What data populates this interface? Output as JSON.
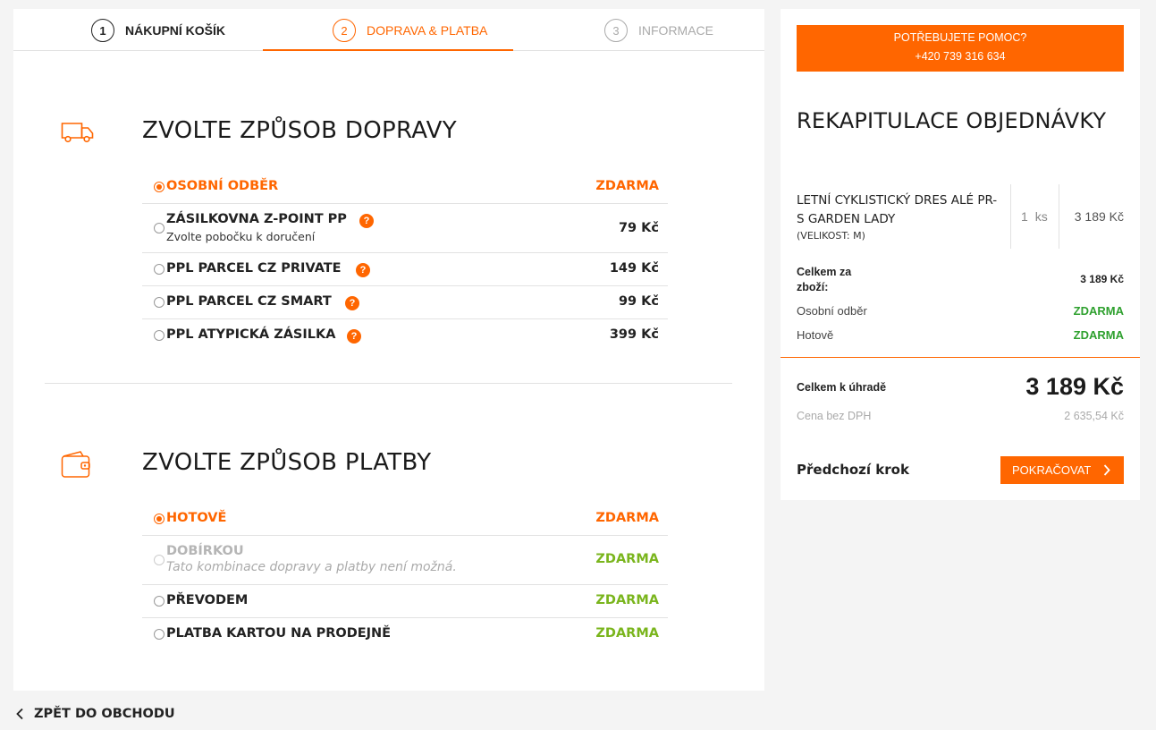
{
  "steps": [
    {
      "num": "1",
      "label": "NÁKUPNÍ KOŠÍK"
    },
    {
      "num": "2",
      "label": "DOPRAVA & PLATBA"
    },
    {
      "num": "3",
      "label": "INFORMACE"
    }
  ],
  "shipping": {
    "title": "ZVOLTE ZPŮSOB DOPRAVY",
    "options": [
      {
        "name": "OSOBNÍ ODBĚR",
        "sub": "",
        "price": "ZDARMA"
      },
      {
        "name": "ZÁSILKOVNA Z-POINT PP",
        "sub": "Zvolte pobočku k doručení",
        "price": "79 Kč",
        "help": "?"
      },
      {
        "name": "PPL PARCEL CZ PRIVATE",
        "sub": "",
        "price": "149 Kč",
        "help": "?"
      },
      {
        "name": "PPL PARCEL CZ SMART",
        "sub": "",
        "price": "99 Kč",
        "help": "?"
      },
      {
        "name": "PPL ATYPICKÁ ZÁSILKA",
        "sub": "",
        "price": "399 Kč",
        "help": "?"
      }
    ]
  },
  "payment": {
    "title": "ZVOLTE ZPŮSOB PLATBY",
    "options": [
      {
        "name": "HOTOVĚ",
        "sub": "",
        "price": "ZDARMA"
      },
      {
        "name": "DOBÍRKOU",
        "sub": "Tato kombinace dopravy a platby není možná.",
        "price": "ZDARMA"
      },
      {
        "name": "PŘEVODEM",
        "sub": "",
        "price": "ZDARMA"
      },
      {
        "name": "PLATBA KARTOU NA PRODEJNĚ",
        "sub": "",
        "price": "ZDARMA"
      }
    ]
  },
  "back_to_shop": "ZPĚT DO OBCHODU",
  "sidebar": {
    "help_line1": "POTŘEBUJETE POMOC?",
    "help_line2": "+420 739 316 634",
    "recap_title": "REKAPITULACE OBJEDNÁVKY",
    "item": {
      "name": "LETNÍ CYKLISTICKÝ DRES ALÉ PR-S GARDEN LADY",
      "variant": "(VELIKOST: M)",
      "qty": "1",
      "qty_unit": "ks",
      "price": "3 189 Kč"
    },
    "goods_total_label": "Celkem za zboží:",
    "goods_total_value": "3 189 Kč",
    "shipping_label": "Osobní odběr",
    "shipping_value": "ZDARMA",
    "payment_label": "Hotově",
    "payment_value": "ZDARMA",
    "total_label": "Celkem k úhradě",
    "total_value": "3 189 Kč",
    "no_vat_label": "Cena bez DPH",
    "no_vat_value": "2 635,54 Kč",
    "prev_step": "Předchozí krok",
    "continue": "POKRAČOVAT"
  },
  "colors": {
    "accent": "#ff6600",
    "green": "#7ab51d",
    "summary_green": "#2ea02e"
  },
  "icons": {
    "shipping": "truck-icon",
    "payment": "wallet-icon",
    "back": "chevron-left-icon",
    "continue": "chevron-right-icon"
  }
}
